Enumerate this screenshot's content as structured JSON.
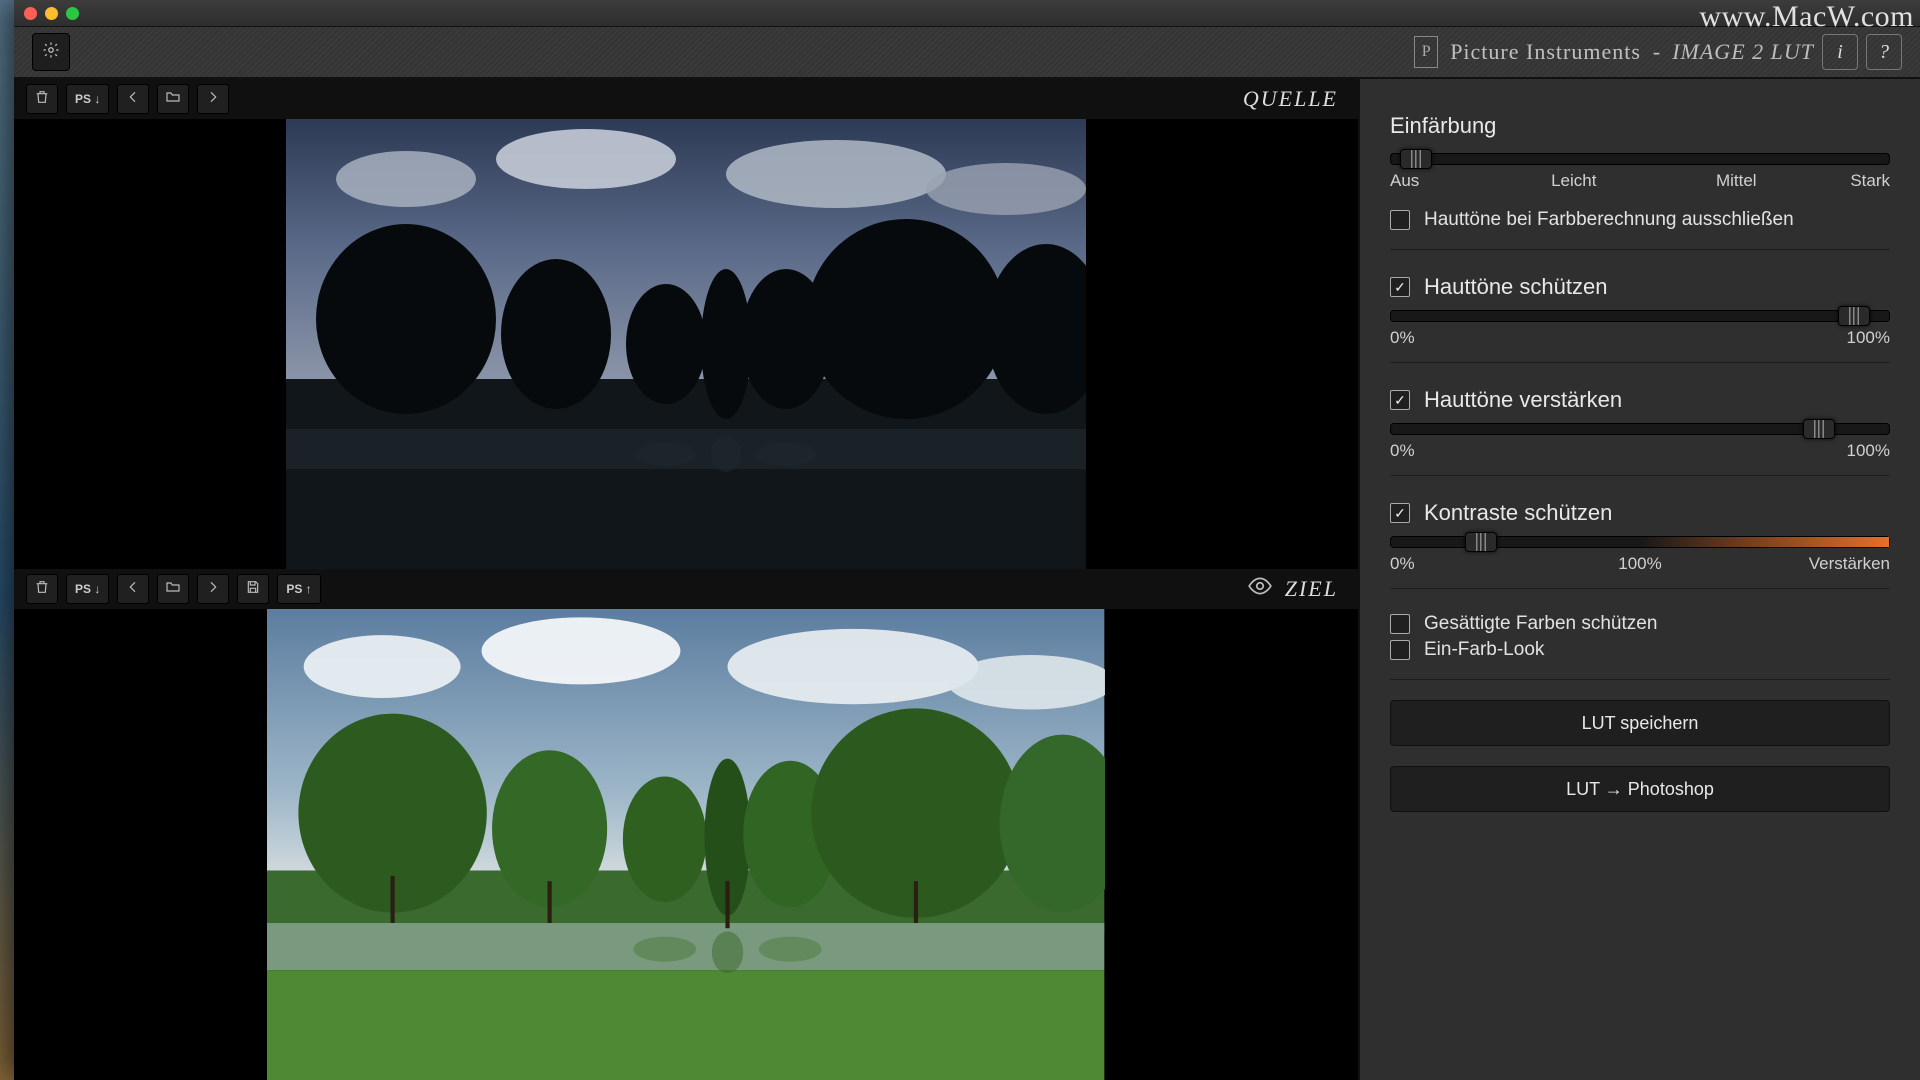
{
  "watermark": "www.MacW.com",
  "brand": {
    "name": "Picture Instruments",
    "product": "image 2 lut",
    "logo": "P"
  },
  "toolbar": {
    "info": "i",
    "help": "?"
  },
  "source": {
    "title": "Quelle",
    "ps_down": "PS ↓"
  },
  "target": {
    "title": "Ziel",
    "ps_down": "PS ↓",
    "ps_up": "PS ↑"
  },
  "sidebar": {
    "tint": {
      "title": "Einfärbung",
      "labels": [
        "Aus",
        "Leicht",
        "Mittel",
        "Stark"
      ],
      "exclude_skin": "Hauttöne bei Farbberechnung ausschließen"
    },
    "protect_skin": {
      "title": "Hauttöne schützen",
      "min": "0%",
      "max": "100%"
    },
    "boost_skin": {
      "title": "Hauttöne verstärken",
      "min": "0%",
      "max": "100%"
    },
    "contrast": {
      "title": "Kontraste schützen",
      "min": "0%",
      "mid": "100%",
      "max": "Verstärken"
    },
    "protect_sat": "Gesättigte Farben schützen",
    "one_color": "Ein-Farb-Look",
    "save_lut": "LUT speichern",
    "lut_ps": "LUT → Photoshop"
  }
}
